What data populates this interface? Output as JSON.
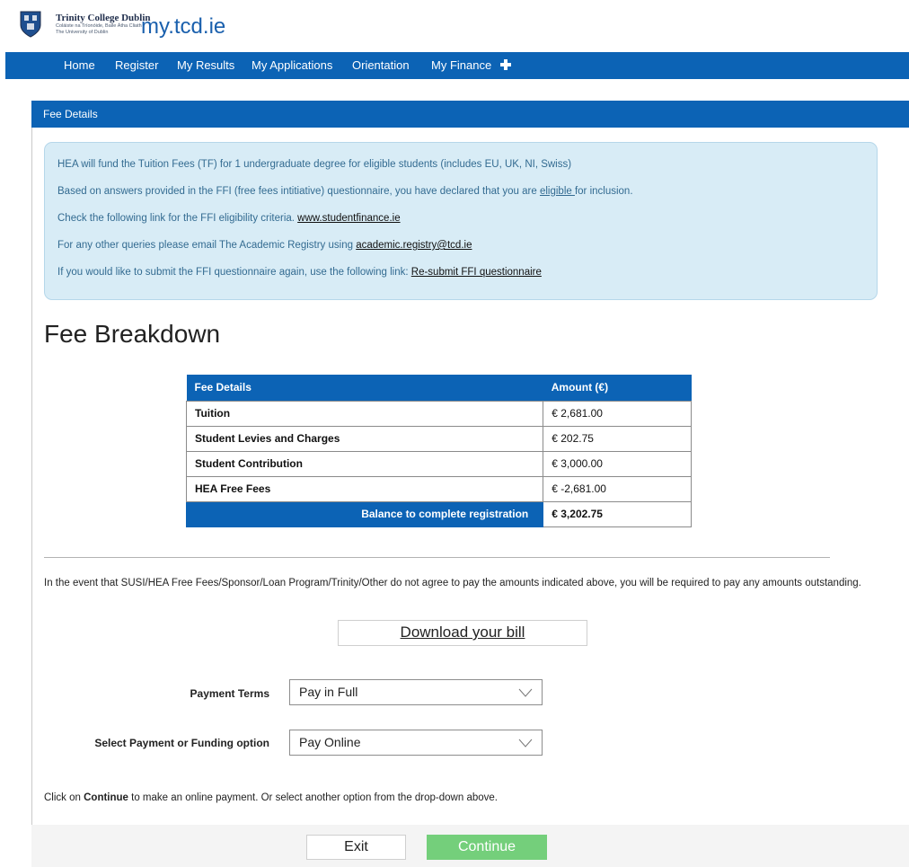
{
  "header": {
    "college_name": "Trinity College Dublin",
    "college_irish": "Coláiste na Tríonóide, Baile Átha Cliath",
    "college_sub": "The University of Dublin",
    "site_title": "my.tcd.ie"
  },
  "nav": {
    "items": [
      "Home",
      "Register",
      "My Results",
      "My Applications",
      "Orientation",
      "My Finance"
    ],
    "plus_icon": "plus-icon"
  },
  "panel": {
    "title": "Fee Details"
  },
  "info": {
    "line1": "HEA will fund the Tuition Fees (TF) for 1 undergraduate degree for eligible students (includes EU, UK, NI, Swiss)",
    "line2_pre": "Based on answers provided in the FFI (free fees intitiative) questionnaire, you have declared that you are ",
    "line2_link": "eligible ",
    "line2_post": "for inclusion.",
    "line3_pre": "Check the following link for the FFI eligibility criteria. ",
    "line3_link": "www.studentfinance.ie",
    "line4_pre": "For any other queries please email The Academic Registry using ",
    "line4_link": "academic.registry@tcd.ie",
    "line5_pre": "If you would like to submit the FFI questionnaire again, use the following link: ",
    "line5_link": "Re-submit FFI questionnaire"
  },
  "breakdown": {
    "title": "Fee Breakdown",
    "col_details": "Fee Details",
    "col_amount": "Amount (€)",
    "rows": [
      {
        "label": "Tuition",
        "amount": "€ 2,681.00"
      },
      {
        "label": "Student Levies and Charges",
        "amount": "€ 202.75"
      },
      {
        "label": "Student Contribution",
        "amount": "€ 3,000.00"
      },
      {
        "label": "HEA Free Fees",
        "amount": "€ -2,681.00"
      }
    ],
    "total_label": "Balance to complete registration",
    "total_amount": "€ 3,202.75"
  },
  "notice": "In the event that SUSI/HEA Free Fees/Sponsor/Loan Program/Trinity/Other do not agree to pay the amounts indicated above, you will be required to pay any amounts outstanding.",
  "download_label": "Download your bill",
  "payment": {
    "terms_label": "Payment Terms",
    "terms_value": "Pay in Full",
    "option_label": "Select Payment or Funding option",
    "option_value": "Pay Online"
  },
  "instruction": {
    "pre": "Click on ",
    "bold": "Continue",
    "post": " to make an online payment. Or select another option from the drop-down above."
  },
  "footer": {
    "exit_label": "Exit",
    "continue_label": "Continue"
  },
  "colors": {
    "brand_blue": "#0c63b5",
    "info_bg": "#d8ecf6",
    "continue_green": "#74cf7b"
  }
}
